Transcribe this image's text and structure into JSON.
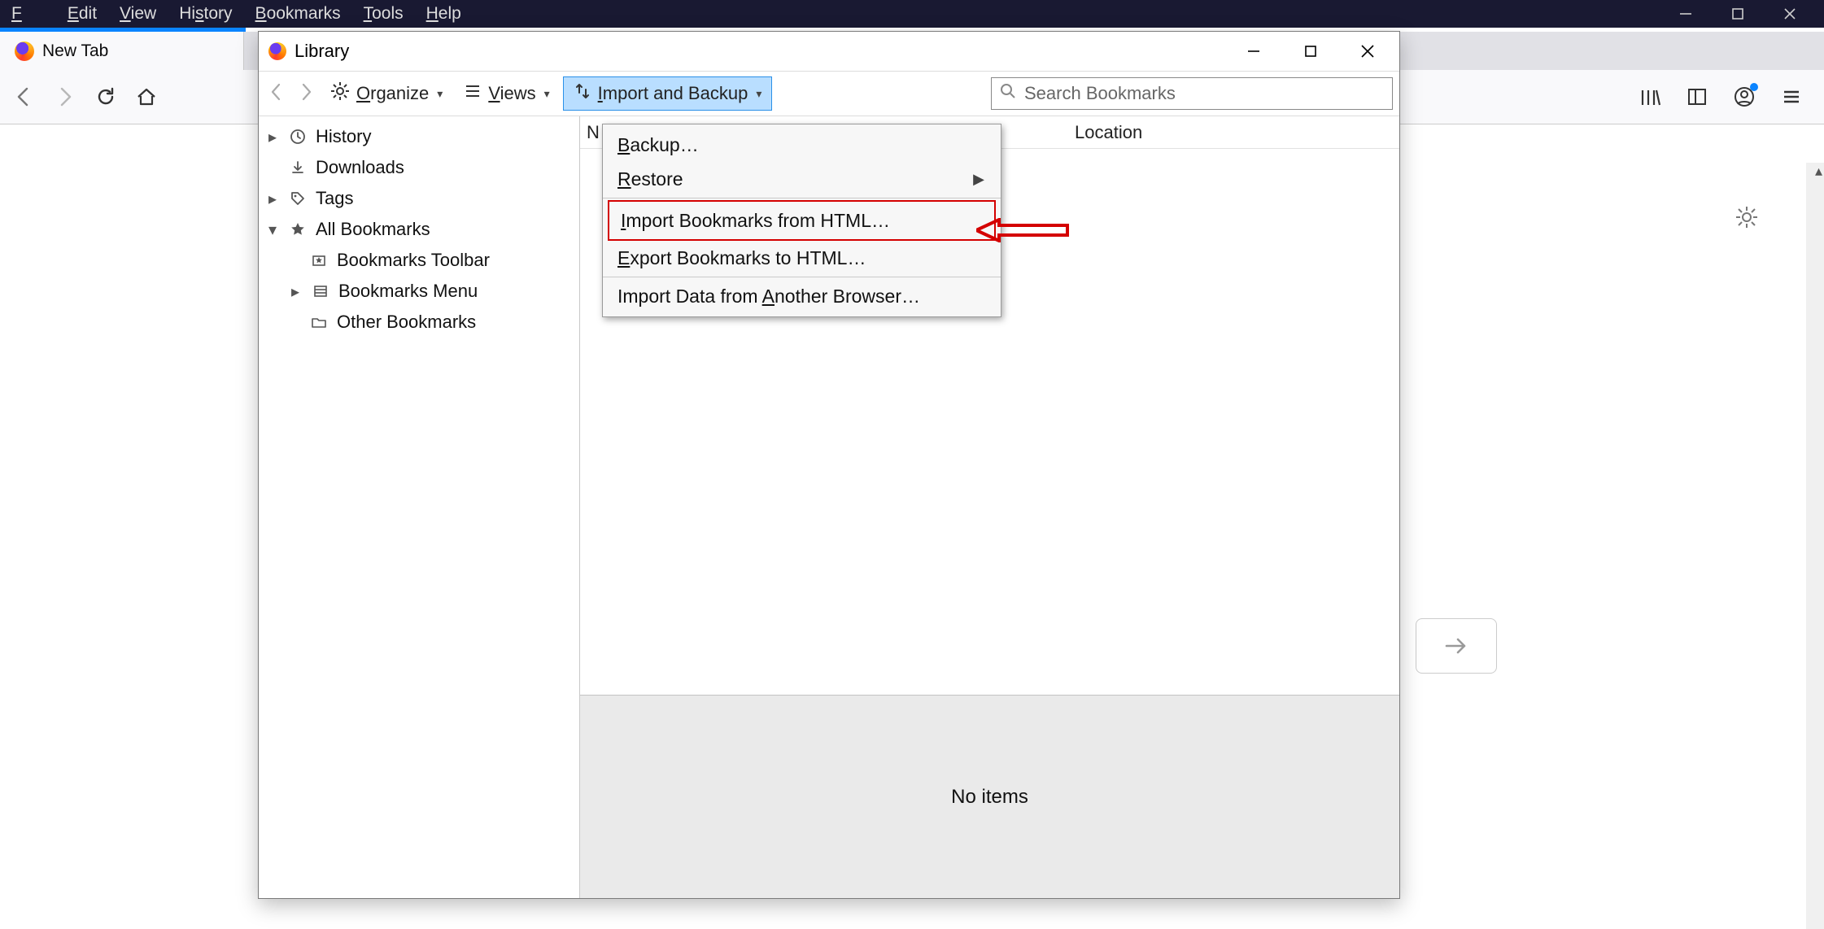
{
  "menubar": {
    "file": "File",
    "edit": "Edit",
    "view": "View",
    "history": "History",
    "bookmarks": "Bookmarks",
    "tools": "Tools",
    "help": "Help"
  },
  "tab": {
    "title": "New Tab"
  },
  "library": {
    "title": "Library",
    "toolbar": {
      "organize": "Organize",
      "views": "Views",
      "import_backup": "Import and Backup",
      "search_placeholder": "Search Bookmarks"
    },
    "tree": {
      "history": "History",
      "downloads": "Downloads",
      "tags": "Tags",
      "all_bookmarks": "All Bookmarks",
      "bookmarks_toolbar": "Bookmarks Toolbar",
      "bookmarks_menu": "Bookmarks Menu",
      "other_bookmarks": "Other Bookmarks"
    },
    "columns": {
      "name": "N",
      "location": "Location"
    },
    "footer": "No items"
  },
  "dropdown": {
    "backup": "Backup…",
    "restore": "Restore",
    "import_html": "Import Bookmarks from HTML…",
    "export_html": "Export Bookmarks to HTML…",
    "import_other": "Import Data from Another Browser…"
  }
}
